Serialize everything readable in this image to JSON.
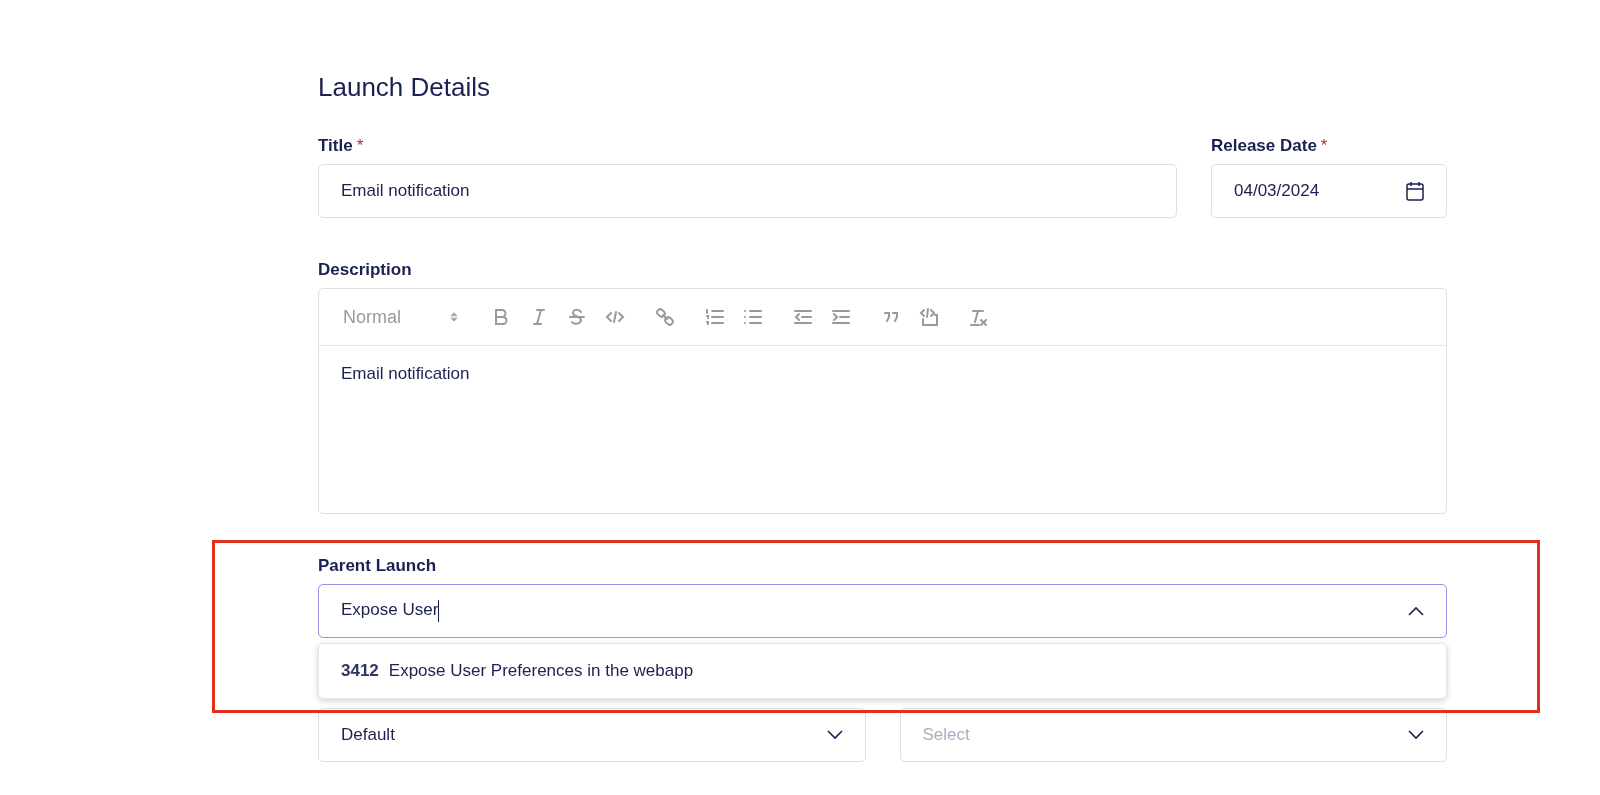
{
  "heading": "Launch Details",
  "title_field": {
    "label": "Title",
    "required_mark": "*",
    "value": "Email notification"
  },
  "release_date": {
    "label": "Release Date",
    "required_mark": "*",
    "value": "04/03/2024"
  },
  "description": {
    "label": "Description",
    "format": "Normal",
    "body": "Email notification"
  },
  "parent_launch": {
    "label": "Parent Launch",
    "value": "Expose User",
    "expanded": true,
    "options": [
      {
        "id": "3412",
        "name": "Expose User Preferences in the webapp"
      }
    ]
  },
  "bottom_selects": [
    {
      "value": "Default"
    },
    {
      "placeholder": "Select"
    }
  ]
}
